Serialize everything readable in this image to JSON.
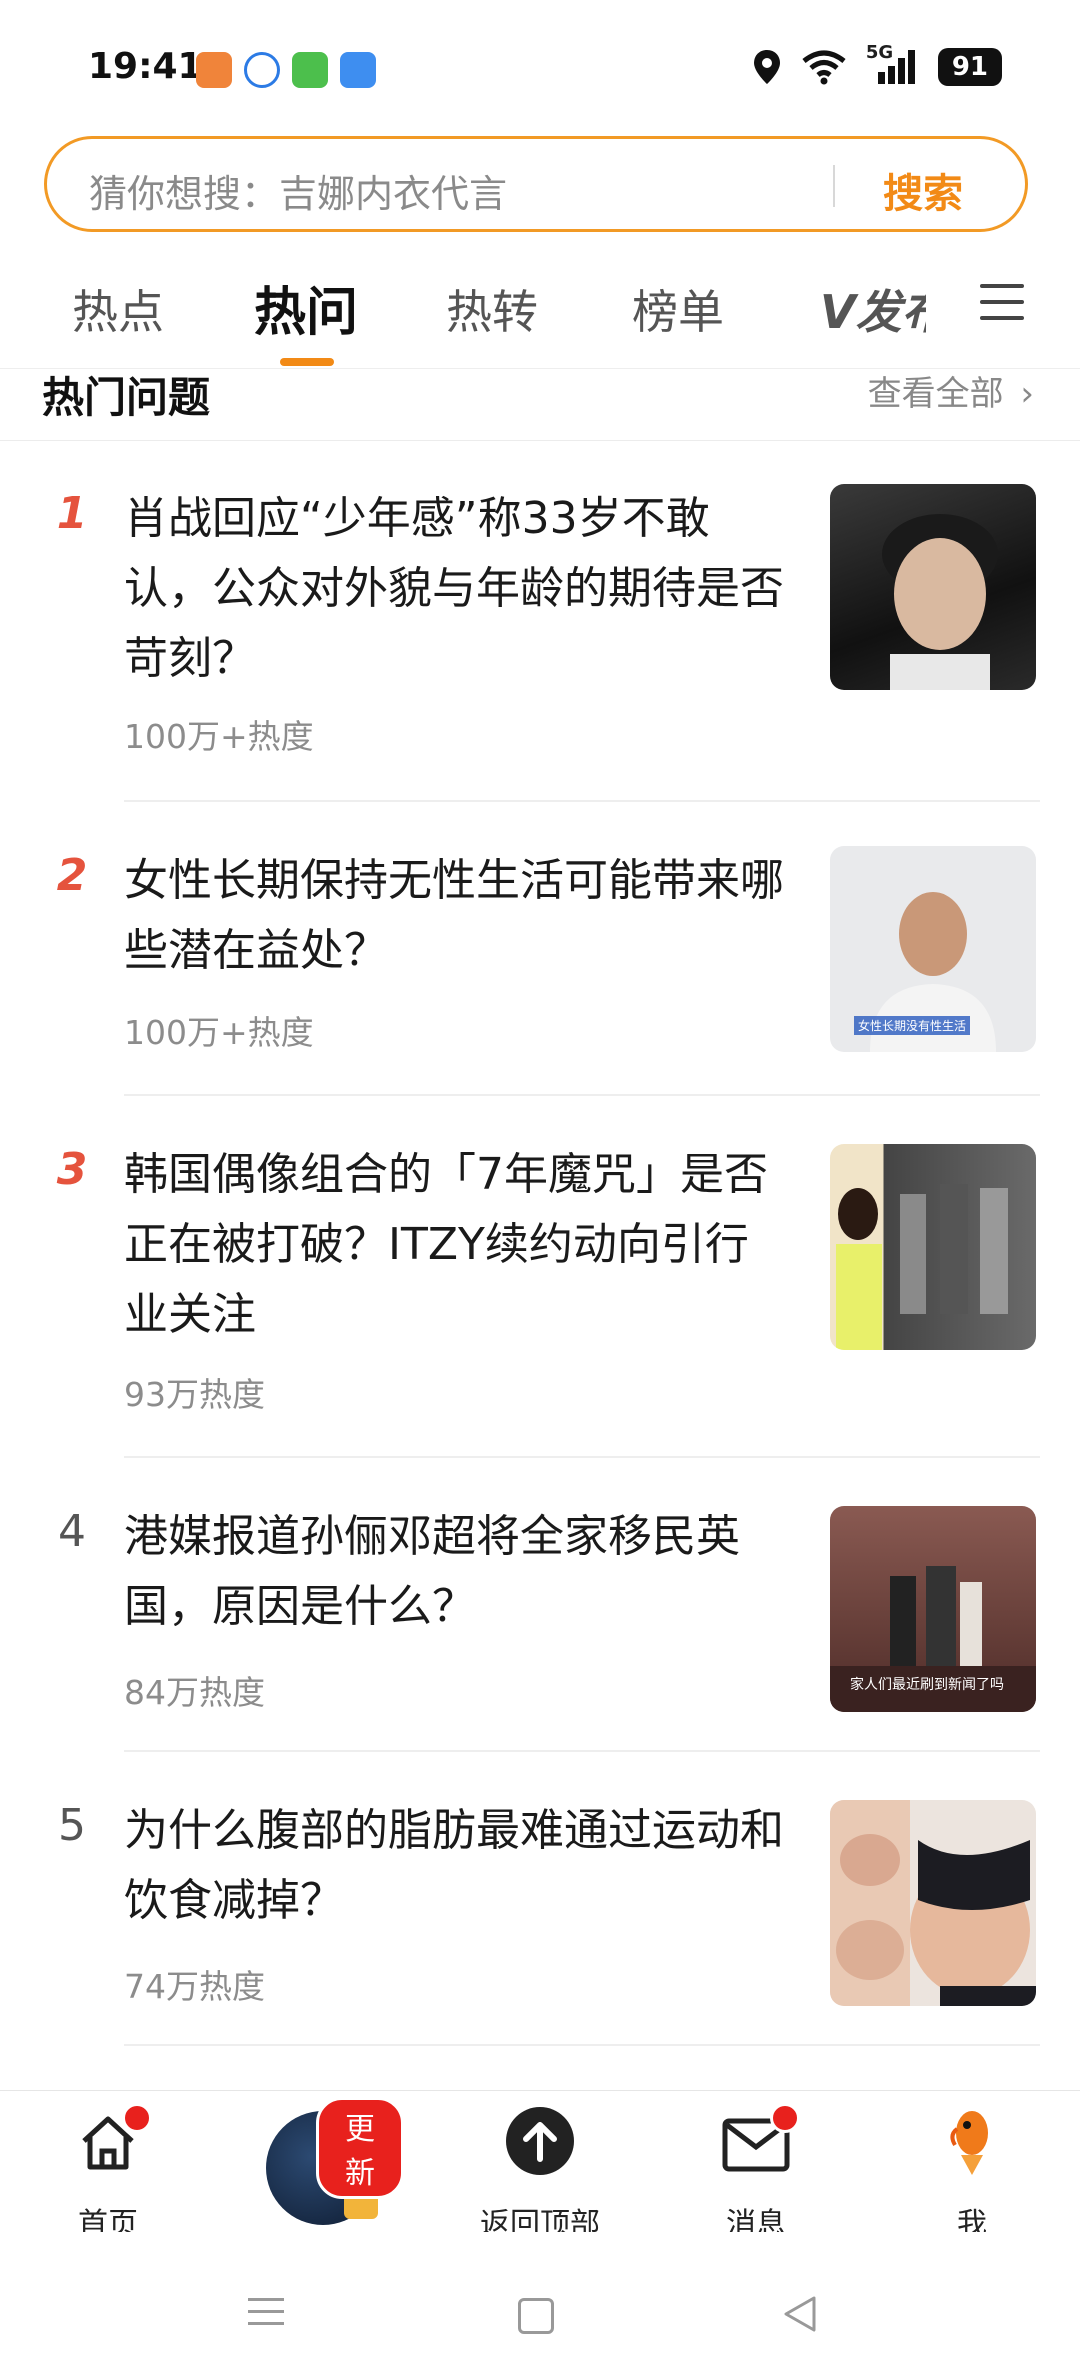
{
  "status_bar": {
    "time": "19:41",
    "network": "5G",
    "battery": "91"
  },
  "search": {
    "placeholder": "猜你想搜：吉娜内衣代言",
    "button": "搜索"
  },
  "tabs": [
    {
      "label": "热点"
    },
    {
      "label": "热问"
    },
    {
      "label": "热转"
    },
    {
      "label": "榜单"
    },
    {
      "label": "V发布"
    }
  ],
  "section": {
    "title": "热门问题",
    "more": "查看全部"
  },
  "items": [
    {
      "rank": "1",
      "title": "肖战回应“少年感”称33岁不敢认，公众对外貌与年龄的期待是否苛刻？",
      "heat": "100万+热度"
    },
    {
      "rank": "2",
      "title": "女性长期保持无性生活可能带来哪些潜在益处？",
      "heat": "100万+热度"
    },
    {
      "rank": "3",
      "title": "韩国偶像组合的「7年魔咒」是否正在被打破？ITZY续约动向引行业关注",
      "heat": "93万热度"
    },
    {
      "rank": "4",
      "title": "港媒报道孙俪邓超将全家移民英国，原因是什么？",
      "heat": "84万热度"
    },
    {
      "rank": "5",
      "title": "为什么腹部的脂肪最难通过运动和饮食减掉？",
      "heat": "74万热度"
    }
  ],
  "thumb_captions": {
    "item2": "女性长期没有性生活",
    "item4": "家人们最近刷到新闻了吗"
  },
  "bottom_nav": {
    "home": "首页",
    "update_badge": "更新",
    "back_to_top": "返回顶部",
    "messages": "消息",
    "me": "我"
  },
  "colors": {
    "accent": "#f28a16",
    "rank_top": "#e5533d",
    "badge": "#e8211d"
  }
}
